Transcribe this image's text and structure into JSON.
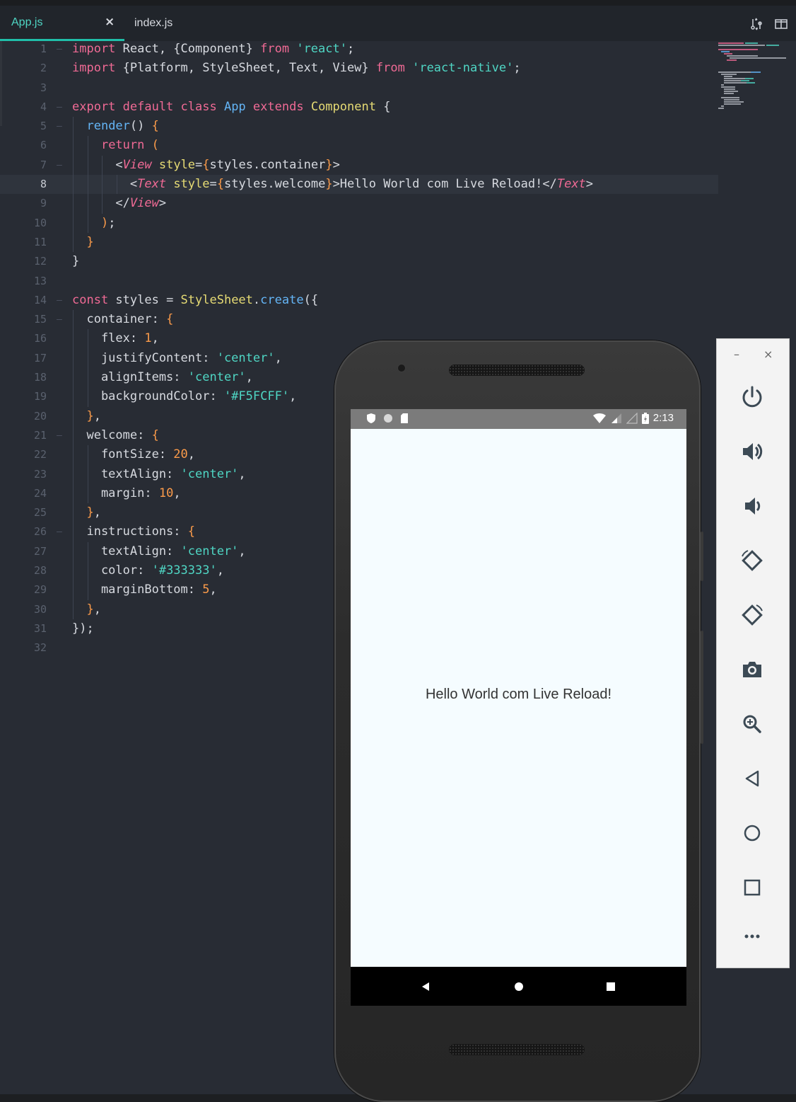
{
  "editor": {
    "tabs": [
      {
        "label": "App.js",
        "active": true
      },
      {
        "label": "index.js",
        "active": false
      }
    ],
    "tab_close_glyph": "×",
    "toolbar_icons": [
      "git-compare-icon",
      "split-view-icon"
    ],
    "current_line": 8,
    "lines": [
      {
        "n": "1"
      },
      {
        "n": "2"
      },
      {
        "n": "3"
      },
      {
        "n": "4"
      },
      {
        "n": "5"
      },
      {
        "n": "6"
      },
      {
        "n": "7"
      },
      {
        "n": "8"
      },
      {
        "n": "9"
      },
      {
        "n": "10"
      },
      {
        "n": "11"
      },
      {
        "n": "12"
      },
      {
        "n": "13"
      },
      {
        "n": "14"
      },
      {
        "n": "15"
      },
      {
        "n": "16"
      },
      {
        "n": "17"
      },
      {
        "n": "18"
      },
      {
        "n": "19"
      },
      {
        "n": "20"
      },
      {
        "n": "21"
      },
      {
        "n": "22"
      },
      {
        "n": "23"
      },
      {
        "n": "24"
      },
      {
        "n": "25"
      },
      {
        "n": "26"
      },
      {
        "n": "27"
      },
      {
        "n": "28"
      },
      {
        "n": "29"
      },
      {
        "n": "30"
      },
      {
        "n": "31"
      },
      {
        "n": "32"
      }
    ],
    "code": [
      [
        [
          "kw",
          "import"
        ],
        [
          "t",
          " React, {Component} "
        ],
        [
          "kw",
          "from"
        ],
        [
          "t",
          " "
        ],
        [
          "str",
          "'react'"
        ],
        [
          "t",
          ";"
        ]
      ],
      [
        [
          "kw",
          "import"
        ],
        [
          "t",
          " {Platform, StyleSheet, Text, View} "
        ],
        [
          "kw",
          "from"
        ],
        [
          "t",
          " "
        ],
        [
          "str",
          "'react-native'"
        ],
        [
          "t",
          ";"
        ]
      ],
      [],
      [
        [
          "kw",
          "export default class"
        ],
        [
          "t",
          " "
        ],
        [
          "fn",
          "App"
        ],
        [
          "t",
          " "
        ],
        [
          "kw",
          "extends"
        ],
        [
          "t",
          " "
        ],
        [
          "attr",
          "Component"
        ],
        [
          "t",
          " {"
        ]
      ],
      [
        [
          "t",
          "  "
        ],
        [
          "fn",
          "render"
        ],
        [
          "t",
          "() "
        ],
        [
          "brace",
          "{"
        ]
      ],
      [
        [
          "t",
          "    "
        ],
        [
          "kw",
          "return"
        ],
        [
          "t",
          " "
        ],
        [
          "brace",
          "("
        ]
      ],
      [
        [
          "t",
          "      <"
        ],
        [
          "tag",
          "View"
        ],
        [
          "t",
          " "
        ],
        [
          "attr",
          "style"
        ],
        [
          "t",
          "="
        ],
        [
          "brace",
          "{"
        ],
        [
          "t",
          "styles.container"
        ],
        [
          "brace",
          "}"
        ],
        [
          "t",
          ">"
        ]
      ],
      [
        [
          "t",
          "        <"
        ],
        [
          "tag",
          "Text"
        ],
        [
          "t",
          " "
        ],
        [
          "attr",
          "style"
        ],
        [
          "t",
          "="
        ],
        [
          "brace",
          "{"
        ],
        [
          "t",
          "styles.welcome"
        ],
        [
          "brace",
          "}"
        ],
        [
          "t",
          ">Hello World com Live Reload!</"
        ],
        [
          "tag",
          "Text"
        ],
        [
          "t",
          ">"
        ]
      ],
      [
        [
          "t",
          "      </"
        ],
        [
          "tag",
          "View"
        ],
        [
          "t",
          ">"
        ]
      ],
      [
        [
          "t",
          "    "
        ],
        [
          "brace",
          ")"
        ],
        [
          "t",
          ";"
        ]
      ],
      [
        [
          "t",
          "  "
        ],
        [
          "brace",
          "}"
        ]
      ],
      [
        [
          "t",
          "}"
        ]
      ],
      [],
      [
        [
          "kw",
          "const"
        ],
        [
          "t",
          " styles = "
        ],
        [
          "attr",
          "StyleSheet"
        ],
        [
          "t",
          "."
        ],
        [
          "fn",
          "create"
        ],
        [
          "t",
          "({"
        ]
      ],
      [
        [
          "t",
          "  container: "
        ],
        [
          "brace",
          "{"
        ]
      ],
      [
        [
          "t",
          "    flex: "
        ],
        [
          "num",
          "1"
        ],
        [
          "t",
          ","
        ]
      ],
      [
        [
          "t",
          "    justifyContent: "
        ],
        [
          "str",
          "'center'"
        ],
        [
          "t",
          ","
        ]
      ],
      [
        [
          "t",
          "    alignItems: "
        ],
        [
          "str",
          "'center'"
        ],
        [
          "t",
          ","
        ]
      ],
      [
        [
          "t",
          "    backgroundColor: "
        ],
        [
          "str",
          "'#F5FCFF'"
        ],
        [
          "t",
          ","
        ]
      ],
      [
        [
          "t",
          "  "
        ],
        [
          "brace",
          "}"
        ],
        [
          "t",
          ","
        ]
      ],
      [
        [
          "t",
          "  welcome: "
        ],
        [
          "brace",
          "{"
        ]
      ],
      [
        [
          "t",
          "    fontSize: "
        ],
        [
          "num",
          "20"
        ],
        [
          "t",
          ","
        ]
      ],
      [
        [
          "t",
          "    textAlign: "
        ],
        [
          "str",
          "'center'"
        ],
        [
          "t",
          ","
        ]
      ],
      [
        [
          "t",
          "    margin: "
        ],
        [
          "num",
          "10"
        ],
        [
          "t",
          ","
        ]
      ],
      [
        [
          "t",
          "  "
        ],
        [
          "brace",
          "}"
        ],
        [
          "t",
          ","
        ]
      ],
      [
        [
          "t",
          "  instructions: "
        ],
        [
          "brace",
          "{"
        ]
      ],
      [
        [
          "t",
          "    textAlign: "
        ],
        [
          "str",
          "'center'"
        ],
        [
          "t",
          ","
        ]
      ],
      [
        [
          "t",
          "    color: "
        ],
        [
          "str",
          "'#333333'"
        ],
        [
          "t",
          ","
        ]
      ],
      [
        [
          "t",
          "    marginBottom: "
        ],
        [
          "num",
          "5"
        ],
        [
          "t",
          ","
        ]
      ],
      [
        [
          "t",
          "  "
        ],
        [
          "brace",
          "}"
        ],
        [
          "t",
          ","
        ]
      ],
      [
        [
          "t",
          "});"
        ]
      ],
      []
    ]
  },
  "phone": {
    "status_time": "2:13",
    "screen_text": "Hello World com Live Reload!",
    "screen_bg": "#F5FCFF"
  },
  "emulator_toolbar": {
    "minimize_glyph": "–",
    "close_glyph": "×",
    "buttons": [
      "power-icon",
      "volume-up-icon",
      "volume-down-icon",
      "rotate-left-icon",
      "rotate-right-icon",
      "camera-icon",
      "zoom-icon",
      "back-icon",
      "home-icon",
      "overview-icon",
      "more-icon"
    ]
  },
  "colors": {
    "accent": "#20bfa9",
    "keyword": "#f06a95",
    "string": "#4fd6c4",
    "function": "#64b5f6",
    "number": "#fb9b4a"
  }
}
